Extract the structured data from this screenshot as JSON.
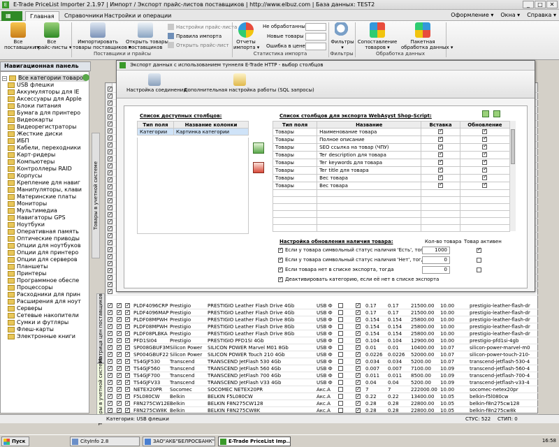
{
  "window": {
    "title": "E-Trade PriceList Importer 2.1.97   |   Импорт / Экспорт прайс-листов поставщиков   |   http://www.elbuz.com   |   База данных: TEST2",
    "buttons": [
      "_",
      "□",
      "✕"
    ]
  },
  "ribbon_tabs": [
    "Главная",
    "Справочники",
    "Настройки и операции"
  ],
  "ribbon_right": [
    "Оформление ▾",
    "Окна ▾",
    "Справка ▾"
  ],
  "ribbon": {
    "all_suppliers": "Все\nпоставщики ▾",
    "all_pricelists": "Все\nпрайс-листы ▾",
    "import_goods": "Импортировать\nтовары поставщиков ▾",
    "open_goods": "Открыть товары\nпоставщиков",
    "pricelist_settings": "Настройки прайс-листа",
    "import_rules": "Правила импорта",
    "open_pricelist": "Открыть прайс-лист",
    "reports": "Отчеты\nимпорта ▾",
    "unprocessed": "Не обработанные",
    "new_goods": "Новые товары",
    "price_error": "Ошибка в цене",
    "filters": "Фильтры\n▾",
    "mapping": "Сопоставление\nтоваров ▾",
    "batch": "Пакетная\nобработка данных ▾",
    "groups": [
      "Поставщики и прайсы",
      "Статистика импорта",
      "Фильтры",
      "Обработка данных"
    ]
  },
  "nav": {
    "header": "Навигационная панель",
    "root": "Все категории товаров",
    "items": [
      "USB флешки",
      "Аккумуляторы для IE",
      "Аксессуары для Apple",
      "Блоки питания",
      "Бумага для принтеро",
      "Видеокарты",
      "Видеорегистраторы",
      "Жесткие диски",
      "ИБП",
      "Кабели, переходники",
      "Карт-ридеры",
      "Компьютеры",
      "Контроллеры RAID",
      "Корпусы",
      "Крепление для навиг",
      "Манипуляторы, клави",
      "Материнские платы",
      "Мониторы",
      "Мультимедиа",
      "Навигаторы GPS",
      "Ноутбуки",
      "Оперативная память",
      "Оптические приводы",
      "Опции для ноутбуков",
      "Опции для принтеро",
      "Опции для серверов",
      "Планшеты",
      "Принтеры",
      "Программное обеспе",
      "Процессоры",
      "Расходники для прин",
      "Расширения для ноут",
      "Серверы",
      "Сетевые накопители",
      "Сумки и футляры",
      "Флеш-карты",
      "Электронные книги"
    ]
  },
  "vtabs": [
    "Товары в учетной системе",
    "Матрица цен поставщиков",
    "Товары в учетной системе"
  ],
  "grid_rows": [
    [
      "PLDF4096CRP",
      "Prestigio",
      "PRESTIGIO Leather Flash Drive 4Gb",
      "USB Ф",
      "0.17",
      "0.17",
      "21500.00",
      "10.00",
      "prestigio-leather-flash-dr"
    ],
    [
      "PLDF4096MAP",
      "Prestigio",
      "PRESTIGIO Leather Flash Drive 4Gb",
      "USB Ф",
      "0.17",
      "0.17",
      "21500.00",
      "10.00",
      "prestigio-leather-flash-dr"
    ],
    [
      "PLDF08MPWH",
      "Prestigio",
      "PRESTIGIO Leather Flash Drive 8Gb",
      "USB Ф",
      "0.154",
      "0.154",
      "25800.00",
      "10.00",
      "prestigio-leather-flash-dr"
    ],
    [
      "PLDF08MPWH",
      "Prestigio",
      "PRESTIGIO Leather Flash Drive 8Gb",
      "USB Ф",
      "0.154",
      "0.154",
      "25800.00",
      "10.00",
      "prestigio-leather-flash-dr"
    ],
    [
      "PLDF08PLBKA",
      "Prestigio",
      "PRESTIGIO Leather Flash Drive 8Gb",
      "USB Ф",
      "0.154",
      "0.154",
      "25800.00",
      "10.00",
      "prestigio-leather-flash-dr"
    ],
    [
      "PFD1SI04",
      "Prestigio",
      "PRESTIGIO PFD1SI 4Gb",
      "USB Ф",
      "0.104",
      "0.104",
      "12900.00",
      "10.00",
      "prestigio-pfd1si-4gb"
    ],
    [
      "SP008GBUF3M",
      "Silicon Power",
      "SILICON POWER Marvel M01 8Gb",
      "USB Ф",
      "0.01",
      "0.01",
      "10400.00",
      "10.07",
      "silicon-power-marvel-m0"
    ],
    [
      "SP004GBUF22",
      "Silicon Power",
      "SILICON POWER Touch 210 4Gb",
      "USB Ф",
      "0.0226",
      "0.0226",
      "52000.00",
      "10.07",
      "silicon-power-touch-210-"
    ],
    [
      "TS4GJF530",
      "Transcend",
      "TRANSCEND JetFlash 530 4Gb",
      "USB Ф",
      "0.034",
      "0.034",
      "5200.00",
      "10.07",
      "transcend-jetflash-530-4"
    ],
    [
      "TS4GJF560",
      "Transcend",
      "TRANSCEND JetFlash 560 4Gb",
      "USB Ф",
      "0.007",
      "0.007",
      "7100.00",
      "10.09",
      "transcend-jetflash-560-4"
    ],
    [
      "TS4GJF700",
      "Transcend",
      "TRANSCEND JetFlash 700 4Gb",
      "USB Ф",
      "0.011",
      "0.011",
      "8500.00",
      "10.09",
      "transcend-jetflash-700-4"
    ],
    [
      "TS4GJFV33",
      "Transcend",
      "TRANSCEND JetFlash V33 4Gb",
      "USB Ф",
      "0.04",
      "0.04",
      "5200.00",
      "10.09",
      "transcend-jetflash-v33-4"
    ],
    [
      "NETEX20PR",
      "Socomec",
      "SOCOMEC NETEX20PR",
      "Акс.А",
      "7",
      "7",
      "222000.00",
      "10.00",
      "socomec-netex20pr"
    ],
    [
      "F5L080CW",
      "Belkin",
      "BELKIN F5L080CW",
      "Акс.А",
      "0.22",
      "0.22",
      "13400.00",
      "10.05",
      "belkin-f5l080cw"
    ],
    [
      "F8N275CW12E",
      "Belkin",
      "BELKIN F8N275CW128",
      "Акс.А",
      "0.28",
      "0.28",
      "22800.00",
      "10.05",
      "belkin-f8n275cw128"
    ],
    [
      "F8N275CW8K",
      "Belkin",
      "BELKIN F8N275CW8K",
      "Акс.А",
      "0.28",
      "0.28",
      "22800.00",
      "10.05",
      "belkin-f8n275cw8k"
    ]
  ],
  "status": {
    "left": "Категория: USB флешки",
    "count": "СТУС: 522",
    "stip": "СТИП: 0"
  },
  "taskbar": [
    "Пуск",
    "CityInfo 2.8",
    "ЗАО\"АКБ\"БЕЛРОСБАНК\"...",
    "E-Trade PriceList Imp...",
    "16:58"
  ],
  "dialog": {
    "title": "Экспорт данных с использованием туннеля E-Trade HTTP - выбор столбцов",
    "tool_conn": "Настройка соединения",
    "tool_sql": "Дополнительная настройка работы (SQL запросы)",
    "avail_title": "Список доступных столбцов:",
    "avail_headers": [
      "Тип поля",
      "Название колонки"
    ],
    "avail_rows": [
      [
        "Категории",
        "Картинка категории"
      ]
    ],
    "export_title": "Список столбцов для экспорта WebAsyst Shop-Script:",
    "export_headers": [
      "Тип поля",
      "Название",
      "Вставка",
      "Обновление"
    ],
    "export_rows": [
      [
        "Товары",
        "Наименование товара"
      ],
      [
        "Товары",
        "Полное описание"
      ],
      [
        "Товары",
        "SEO ссылка на товар (ЧПУ)"
      ],
      [
        "Товары",
        "Teг description для товара"
      ],
      [
        "Товары",
        "Teг keywords для товара"
      ],
      [
        "Товары",
        "Teг title для товара"
      ],
      [
        "Товары",
        "Вес товара"
      ],
      [
        "Товары",
        "Вес товара"
      ]
    ],
    "update_title": "Настройка обновления наличия товара:",
    "qty_header": "Кол-во товара",
    "active_header": "Товар активен",
    "opts": [
      {
        "label": "Если у товара символьный статус наличия 'Есть', тогда",
        "qty": "1000",
        "active": true
      },
      {
        "label": "Если у товара символьный статус наличия 'Нет', тогда",
        "qty": "0",
        "active": false
      },
      {
        "label": "Если товара нет в списке экспорта, тогда",
        "qty": "0",
        "active": false
      },
      {
        "label": "Деактивировать категорию, если её нет в списке экспорта",
        "qty": "",
        "active": false
      }
    ]
  }
}
